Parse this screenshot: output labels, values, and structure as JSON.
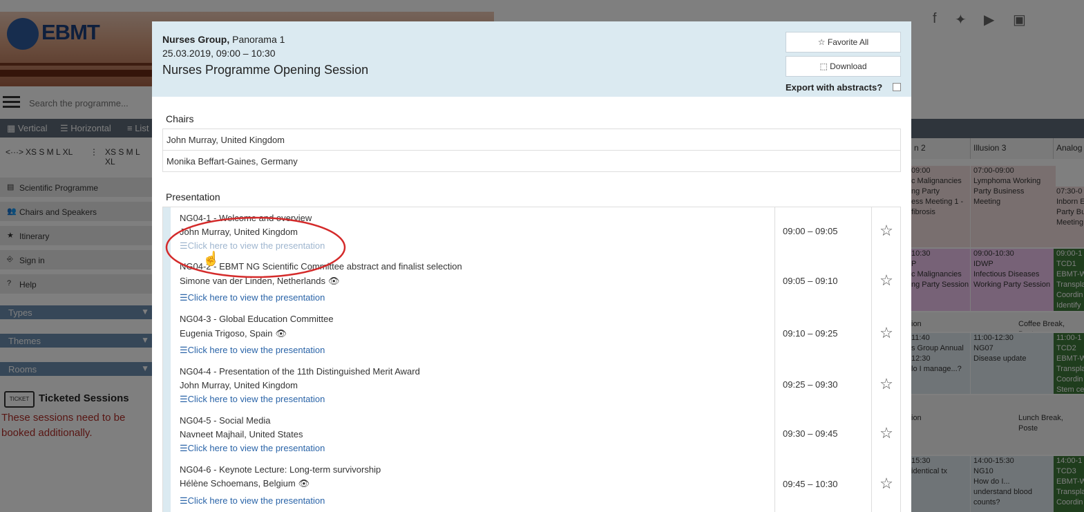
{
  "bg": {
    "logo": "EBMT",
    "search_placeholder": "Search the programme...",
    "views": [
      "Vertical",
      "Horizontal",
      "List"
    ],
    "size_h": "XS S M L XL",
    "size_v": "XS S M L XL",
    "nav": [
      "Scientific Programme",
      "Chairs and Speakers",
      "Itinerary",
      "Sign in",
      "Help"
    ],
    "dropdowns": [
      "Types",
      "Themes",
      "Rooms"
    ],
    "ticket_badge": "TICKET",
    "ticket_title": "Ticketed Sessions",
    "ticket_note": "These sessions need to be booked additionally.",
    "cols": [
      "n 2",
      "Illusion 3",
      "Analog"
    ],
    "cells": {
      "c1": [
        "09:00",
        "c Malignancies",
        "ng Party",
        "ess Meeting 1 -",
        "fibrosis"
      ],
      "c2": [
        "07:00-09:00",
        "Lymphoma Working",
        "Party Business",
        "Meeting"
      ],
      "c3": [
        "07:30-0",
        "Inborn E",
        "Party Bu",
        "Meeting"
      ],
      "c4": [
        "10:30",
        "P",
        "c Malignancies",
        "ng Party Session"
      ],
      "c5": [
        "09:00-10:30",
        "IDWP",
        "Infectious Diseases",
        "Working Party Session"
      ],
      "c6": [
        "09:00-1",
        "TCD1",
        "EBMT-W",
        "Transpla",
        "Coordin",
        "Identify"
      ],
      "c7": [
        "ion"
      ],
      "c8": [
        "Coffee Break, Poste"
      ],
      "c9": [
        "11:40",
        "s Group Annual",
        "12:30",
        "",
        "lo I manage...?"
      ],
      "c10": [
        "11:00-12:30",
        "NG07",
        "Disease update"
      ],
      "c11": [
        "11:00-1",
        "TCD2",
        "EBMT-W",
        "Transpla",
        "Coordin",
        "Stem ce"
      ],
      "c12": [
        "ion"
      ],
      "c13": [
        "Lunch Break, Poste"
      ],
      "c14": [
        "15:30",
        "",
        "identical tx"
      ],
      "c15": [
        "14:00-15:30",
        "NG10",
        "How do I...",
        "understand blood",
        "counts?"
      ],
      "c16": [
        "14:00-1",
        "TCD3",
        "EBMT-W",
        "Transpla",
        "Coordin"
      ]
    },
    "colors": {
      "header": "#5f6a78",
      "nav": "#e9e9e9",
      "dropdown": "#6d8fb0",
      "warning": "#b02c27"
    }
  },
  "modal": {
    "group": "Nurses Group,",
    "room": " Panorama 1",
    "datetime": "25.03.2019, 09:00 – 10:30",
    "title": "Nurses Programme Opening Session",
    "favorite_all": "☆ Favorite All",
    "download": "⬚ Download",
    "export_label": "Export with abstracts?",
    "chairs_label": "Chairs",
    "chairs": [
      "John Murray, United Kingdom",
      "Monika Beffart-Gaines, Germany"
    ],
    "presentation_label": "Presentation",
    "link_text": "☰Click here to view the presentation",
    "presentations": [
      {
        "title": "NG04-1 - Welcome and overview",
        "speaker": "John Murray, United Kingdom",
        "time": "09:00 – 09:05"
      },
      {
        "title": "NG04-2 - EBMT NG Scientific Committee abstract and finalist selection",
        "speaker": "Simone van der Linden, Netherlands",
        "time": "09:05 – 09:10"
      },
      {
        "title": "NG04-3 - Global Education Committee",
        "speaker": "Eugenia Trigoso, Spain",
        "time": "09:10 – 09:25"
      },
      {
        "title": "NG04-4 - Presentation of the 11th Distinguished Merit Award",
        "speaker": "John Murray, United Kingdom",
        "time": "09:25 – 09:30"
      },
      {
        "title": "NG04-5 - Social Media",
        "speaker": "Navneet Majhail, United States",
        "time": "09:30 – 09:45"
      },
      {
        "title": "NG04-6 - Keynote Lecture: Long-term survivorship",
        "speaker": "Hélène Schoemans, Belgium",
        "time": "09:45 – 10:30"
      }
    ],
    "colors": {
      "header_bg": "#dbeaf1",
      "link": "#2a64a8",
      "annotation": "#d42a2a"
    }
  }
}
